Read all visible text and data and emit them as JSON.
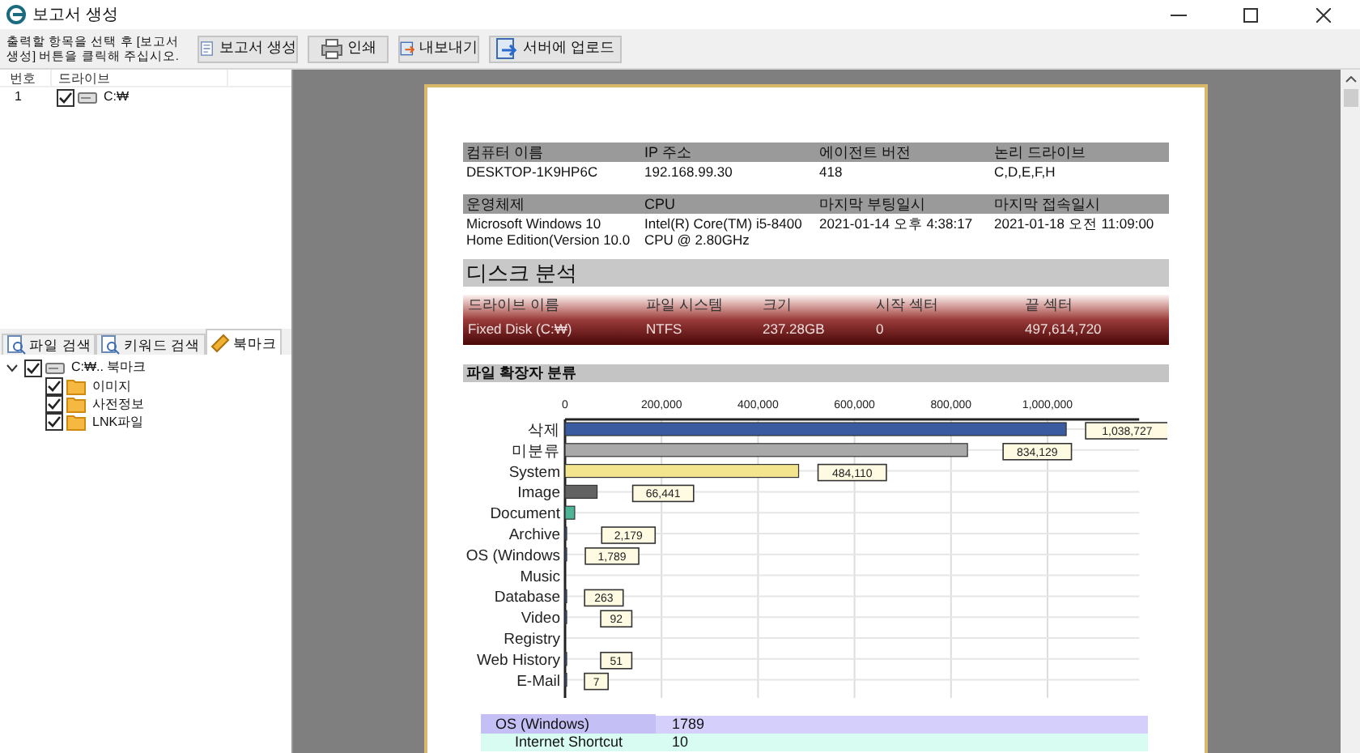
{
  "window": {
    "title": "보고서 생성"
  },
  "toolbar": {
    "instruction": "출력할 항목을 선택 후 [보고서 생성] 버튼을 클릭해 주십시오.",
    "buttons": [
      {
        "label": "보고서 생성",
        "kind": "report"
      },
      {
        "label": "인쇄",
        "kind": "print"
      },
      {
        "label": "내보내기",
        "kind": "export"
      },
      {
        "label": "서버에 업로드",
        "kind": "upload"
      }
    ]
  },
  "drive_list": {
    "columns": [
      "번호",
      "드라이브"
    ],
    "rows": [
      {
        "number": "1",
        "drive": "C:₩",
        "checked": true
      }
    ]
  },
  "bottom_tabs": [
    {
      "label": "파일 검색",
      "kind": "search",
      "selected": false
    },
    {
      "label": "키워드 검색",
      "kind": "search",
      "selected": false
    },
    {
      "label": "북마크",
      "kind": "bookmark",
      "selected": true
    }
  ],
  "tree": {
    "label": "C:₩.. 북마크",
    "checked": true,
    "expanded": true,
    "children": [
      {
        "label": "이미지",
        "checked": true
      },
      {
        "label": "사전정보",
        "checked": true
      },
      {
        "label": "LNK파일",
        "checked": true
      }
    ]
  },
  "report": {
    "system_info": [
      {
        "columns": [
          "컴퓨터 이름",
          "IP 주소",
          "에이전트 버전",
          "논리 드라이브"
        ],
        "values": [
          "DESKTOP-1K9HP6C",
          "192.168.99.30",
          "418",
          "C,D,E,F,H"
        ]
      },
      {
        "columns": [
          "운영체제",
          "CPU",
          "마지막 부팅일시",
          "마지막 접속일시"
        ],
        "values": [
          "Microsoft Windows 10 Home Edition(Version 10.0",
          "Intel(R) Core(TM) i5-8400 CPU @ 2.80GHz",
          "2021-01-14 오후 4:38:17",
          "2021-01-18 오전 11:09:00"
        ]
      }
    ],
    "disk_section": {
      "title": "디스크 분석",
      "columns": [
        "드라이브 이름",
        "파일 시스템",
        "크기",
        "시작 섹터",
        "끝 섹터"
      ],
      "rows": [
        [
          "Fixed Disk (C:₩)",
          "NTFS",
          "237.28GB",
          "0",
          "497,614,720"
        ]
      ]
    },
    "extension_section": {
      "title": "파일 확장자 분류",
      "chart_data": {
        "type": "bar",
        "orientation": "horizontal",
        "categories": [
          "삭제",
          "미분류",
          "System",
          "Image",
          "Document",
          "Archive",
          "OS (Windows",
          "Music",
          "Database",
          "Video",
          "Registry",
          "Web History",
          "E-Mail"
        ],
        "series": [
          {
            "values": [
              1038727,
              834129,
              484110,
              66441,
              20000,
              2179,
              1789,
              null,
              263,
              92,
              null,
              51,
              7
            ]
          }
        ],
        "colors": [
          "#3a5ba0",
          "#a9a9a9",
          "#f3e48e",
          "#626262",
          "#4db497",
          "#3a5ba0",
          "#3a5ba0",
          null,
          "#3a5ba0",
          "#3a5ba0",
          null,
          "#3a5ba0",
          "#3a5ba0"
        ],
        "grid": true,
        "value_labels": [
          "1,038,727",
          "834,129",
          "484,110",
          "66,441",
          null,
          "2,179",
          "1,789",
          null,
          "263",
          "92",
          null,
          "51",
          "7"
        ],
        "xlim": [
          0,
          1190000
        ],
        "xticks": [
          {
            "value": 0,
            "label": "0"
          },
          {
            "value": 200000,
            "label": "200,000"
          },
          {
            "value": 400000,
            "label": "400,000"
          },
          {
            "value": 600000,
            "label": "600,000"
          },
          {
            "value": 800000,
            "label": "800,000"
          },
          {
            "value": 1000000,
            "label": "1,000,000"
          }
        ]
      }
    },
    "extension_table": [
      {
        "name": "OS (Windows)",
        "count": "1789",
        "color": "#d4d0fb",
        "kind": "group"
      },
      {
        "name": "Internet Shortcut",
        "count": "10",
        "color": "#d8fbf2",
        "kind": "item"
      }
    ]
  }
}
